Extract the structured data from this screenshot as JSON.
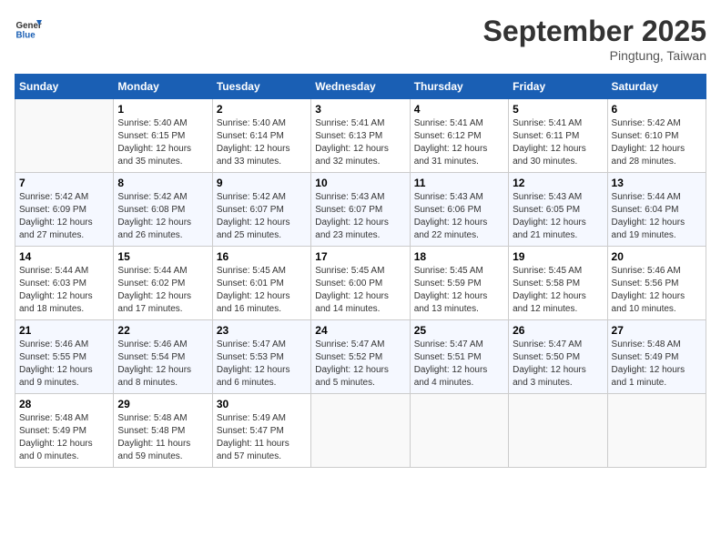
{
  "header": {
    "logo_line1": "General",
    "logo_line2": "Blue",
    "month": "September 2025",
    "location": "Pingtung, Taiwan"
  },
  "columns": [
    "Sunday",
    "Monday",
    "Tuesday",
    "Wednesday",
    "Thursday",
    "Friday",
    "Saturday"
  ],
  "weeks": [
    [
      {
        "day": "",
        "info": ""
      },
      {
        "day": "1",
        "info": "Sunrise: 5:40 AM\nSunset: 6:15 PM\nDaylight: 12 hours\nand 35 minutes."
      },
      {
        "day": "2",
        "info": "Sunrise: 5:40 AM\nSunset: 6:14 PM\nDaylight: 12 hours\nand 33 minutes."
      },
      {
        "day": "3",
        "info": "Sunrise: 5:41 AM\nSunset: 6:13 PM\nDaylight: 12 hours\nand 32 minutes."
      },
      {
        "day": "4",
        "info": "Sunrise: 5:41 AM\nSunset: 6:12 PM\nDaylight: 12 hours\nand 31 minutes."
      },
      {
        "day": "5",
        "info": "Sunrise: 5:41 AM\nSunset: 6:11 PM\nDaylight: 12 hours\nand 30 minutes."
      },
      {
        "day": "6",
        "info": "Sunrise: 5:42 AM\nSunset: 6:10 PM\nDaylight: 12 hours\nand 28 minutes."
      }
    ],
    [
      {
        "day": "7",
        "info": "Sunrise: 5:42 AM\nSunset: 6:09 PM\nDaylight: 12 hours\nand 27 minutes."
      },
      {
        "day": "8",
        "info": "Sunrise: 5:42 AM\nSunset: 6:08 PM\nDaylight: 12 hours\nand 26 minutes."
      },
      {
        "day": "9",
        "info": "Sunrise: 5:42 AM\nSunset: 6:07 PM\nDaylight: 12 hours\nand 25 minutes."
      },
      {
        "day": "10",
        "info": "Sunrise: 5:43 AM\nSunset: 6:07 PM\nDaylight: 12 hours\nand 23 minutes."
      },
      {
        "day": "11",
        "info": "Sunrise: 5:43 AM\nSunset: 6:06 PM\nDaylight: 12 hours\nand 22 minutes."
      },
      {
        "day": "12",
        "info": "Sunrise: 5:43 AM\nSunset: 6:05 PM\nDaylight: 12 hours\nand 21 minutes."
      },
      {
        "day": "13",
        "info": "Sunrise: 5:44 AM\nSunset: 6:04 PM\nDaylight: 12 hours\nand 19 minutes."
      }
    ],
    [
      {
        "day": "14",
        "info": "Sunrise: 5:44 AM\nSunset: 6:03 PM\nDaylight: 12 hours\nand 18 minutes."
      },
      {
        "day": "15",
        "info": "Sunrise: 5:44 AM\nSunset: 6:02 PM\nDaylight: 12 hours\nand 17 minutes."
      },
      {
        "day": "16",
        "info": "Sunrise: 5:45 AM\nSunset: 6:01 PM\nDaylight: 12 hours\nand 16 minutes."
      },
      {
        "day": "17",
        "info": "Sunrise: 5:45 AM\nSunset: 6:00 PM\nDaylight: 12 hours\nand 14 minutes."
      },
      {
        "day": "18",
        "info": "Sunrise: 5:45 AM\nSunset: 5:59 PM\nDaylight: 12 hours\nand 13 minutes."
      },
      {
        "day": "19",
        "info": "Sunrise: 5:45 AM\nSunset: 5:58 PM\nDaylight: 12 hours\nand 12 minutes."
      },
      {
        "day": "20",
        "info": "Sunrise: 5:46 AM\nSunset: 5:56 PM\nDaylight: 12 hours\nand 10 minutes."
      }
    ],
    [
      {
        "day": "21",
        "info": "Sunrise: 5:46 AM\nSunset: 5:55 PM\nDaylight: 12 hours\nand 9 minutes."
      },
      {
        "day": "22",
        "info": "Sunrise: 5:46 AM\nSunset: 5:54 PM\nDaylight: 12 hours\nand 8 minutes."
      },
      {
        "day": "23",
        "info": "Sunrise: 5:47 AM\nSunset: 5:53 PM\nDaylight: 12 hours\nand 6 minutes."
      },
      {
        "day": "24",
        "info": "Sunrise: 5:47 AM\nSunset: 5:52 PM\nDaylight: 12 hours\nand 5 minutes."
      },
      {
        "day": "25",
        "info": "Sunrise: 5:47 AM\nSunset: 5:51 PM\nDaylight: 12 hours\nand 4 minutes."
      },
      {
        "day": "26",
        "info": "Sunrise: 5:47 AM\nSunset: 5:50 PM\nDaylight: 12 hours\nand 3 minutes."
      },
      {
        "day": "27",
        "info": "Sunrise: 5:48 AM\nSunset: 5:49 PM\nDaylight: 12 hours\nand 1 minute."
      }
    ],
    [
      {
        "day": "28",
        "info": "Sunrise: 5:48 AM\nSunset: 5:49 PM\nDaylight: 12 hours\nand 0 minutes."
      },
      {
        "day": "29",
        "info": "Sunrise: 5:48 AM\nSunset: 5:48 PM\nDaylight: 11 hours\nand 59 minutes."
      },
      {
        "day": "30",
        "info": "Sunrise: 5:49 AM\nSunset: 5:47 PM\nDaylight: 11 hours\nand 57 minutes."
      },
      {
        "day": "",
        "info": ""
      },
      {
        "day": "",
        "info": ""
      },
      {
        "day": "",
        "info": ""
      },
      {
        "day": "",
        "info": ""
      }
    ]
  ]
}
